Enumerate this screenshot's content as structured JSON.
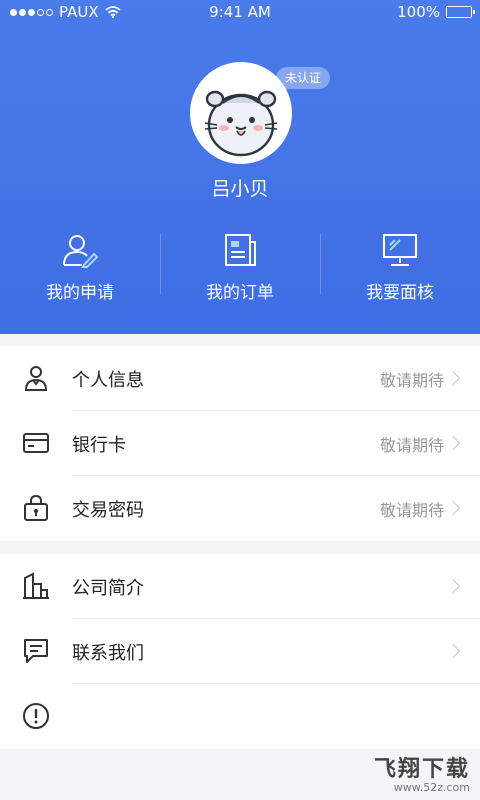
{
  "status_bar": {
    "carrier": "PAUX",
    "time": "9:41 AM",
    "battery": "100%",
    "battery_level": 1.0
  },
  "profile": {
    "badge": "未认证",
    "name": "吕小贝",
    "avatar_icon": "hamster-avatar-icon"
  },
  "quick_actions": [
    {
      "label": "我的申请",
      "icon": "person-edit-icon"
    },
    {
      "label": "我的订单",
      "icon": "document-list-icon"
    },
    {
      "label": "我要面核",
      "icon": "monitor-icon"
    }
  ],
  "menu_group_1": [
    {
      "label": "个人信息",
      "value": "敬请期待",
      "icon": "person-id-icon"
    },
    {
      "label": "银行卡",
      "value": "敬请期待",
      "icon": "bank-card-icon"
    },
    {
      "label": "交易密码",
      "value": "敬请期待",
      "icon": "lock-bag-icon"
    }
  ],
  "menu_group_2": [
    {
      "label": "公司简介",
      "value": "",
      "icon": "building-icon"
    },
    {
      "label": "联系我们",
      "value": "",
      "icon": "chat-message-icon"
    },
    {
      "label": "",
      "value": "",
      "icon": "alert-circle-icon"
    }
  ],
  "colors": {
    "header_bg": "#4476e8",
    "icon_stroke": "#333333",
    "accent_icon": "#4a7bea"
  },
  "watermark": {
    "main": "飞翔下载",
    "sub": "www.52z.com"
  }
}
